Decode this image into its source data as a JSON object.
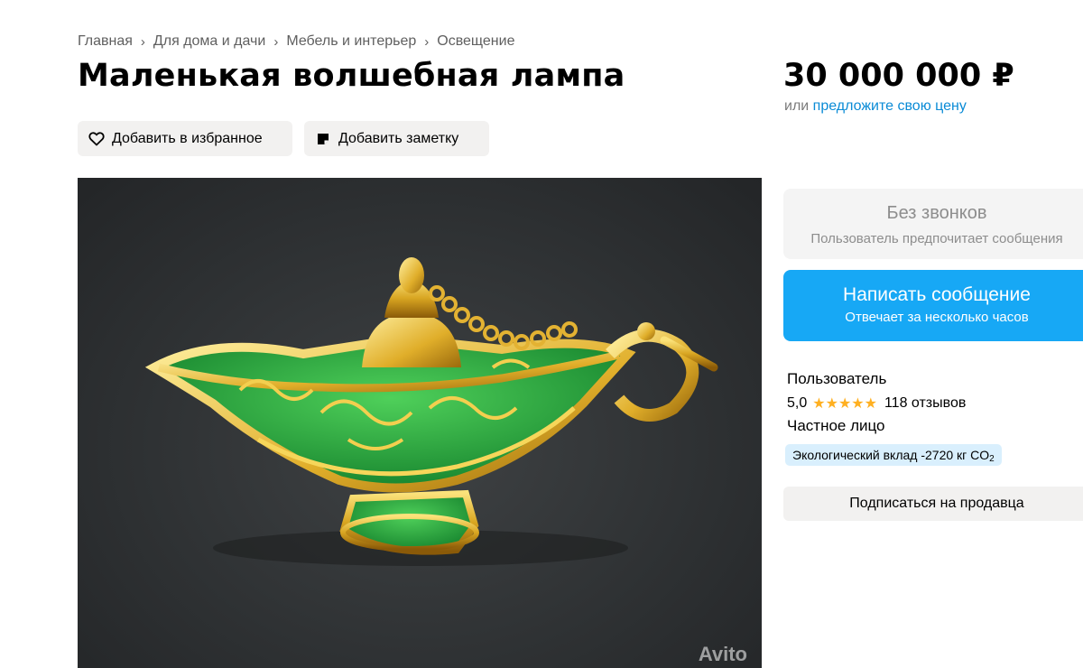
{
  "breadcrumb": {
    "items": [
      "Главная",
      "Для дома и дачи",
      "Мебель и интерьер",
      "Освещение"
    ],
    "separator": "›"
  },
  "listing": {
    "title": "Маленькая волшебная лампа",
    "price": "30 000 000 ₽",
    "price_or": "или",
    "offer_link": "предложите свою цену"
  },
  "actions": {
    "favorite_label": "Добавить в избранное",
    "note_label": "Добавить заметку"
  },
  "contact": {
    "no_calls_title": "Без звонков",
    "no_calls_subtitle": "Пользователь предпочитает сообщения",
    "message_button": "Написать сообщение",
    "message_subtitle": "Отвечает за несколько часов"
  },
  "seller": {
    "name": "Пользователь",
    "rating": "5,0",
    "stars": "★★★★★",
    "reviews": "118 отзывов",
    "type": "Частное лицо",
    "eco_badge": "Экологический вклад -2720 кг CO",
    "eco_sub": "2",
    "subscribe_button": "Подписаться на продавца"
  },
  "photo": {
    "watermark": "Avito"
  },
  "colors": {
    "accent_blue": "#17a8f5",
    "link_blue": "#0a8bd6",
    "star_gold": "#ffb021",
    "eco_bg": "#d9effd",
    "button_gray": "#f2f1f0"
  }
}
